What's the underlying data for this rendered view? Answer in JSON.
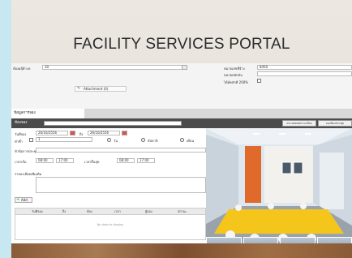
{
  "slide_title": "FACILITY SERVICES PORTAL",
  "form": {
    "location_label": "ห้องผลุ้ห้าะต",
    "location_value": "30",
    "code_label": "หมายเลขที่จ้าง",
    "code_value": "84SS",
    "unit_label": "หน่วยหลักดัน",
    "percent_label": "ได้ห์คลักดี 200%",
    "attachment_label": "Attachment (0)"
  },
  "section": {
    "tab_label": "ข้อมูลการจอง"
  },
  "booking_bar": {
    "room_label": "ห้องจอง",
    "btn_check": "ตรวจสอบสถานะห้อง",
    "btn_book": "จองห้องประชุม"
  },
  "booking": {
    "start_label": "วันที่จอง",
    "start_date": "26/10/2556",
    "to_label": "ถึง",
    "end_date": "26/10/2556",
    "repeat_label": "ทำซ้ำ",
    "repeat_value": "1",
    "opt_day": "วัน",
    "opt_week": "สัปดาห์",
    "opt_month": "เดือน",
    "topic_label": "หัวข้อการประชุม",
    "time_label": "เวลาเริ่ม",
    "time_start_a": "08:00",
    "time_start_b": "17:00",
    "time_end_label": "เวลาสิ้นสุด",
    "time_end_a": "08:00",
    "time_end_b": "17:00",
    "detail_label": "รายละเอียดเพิ่มเติม",
    "add_label": "Add"
  },
  "grid": {
    "columns": [
      "วันที่จอง",
      "ถึง",
      "ห้อง",
      "เวลา",
      "ผู้จอง",
      "สถานะ"
    ],
    "empty_text": "No data to display"
  },
  "colors": {
    "dark_bar": "#4b4b4b",
    "accent_wall": "#e06a2c",
    "table": "#f4c61c"
  }
}
